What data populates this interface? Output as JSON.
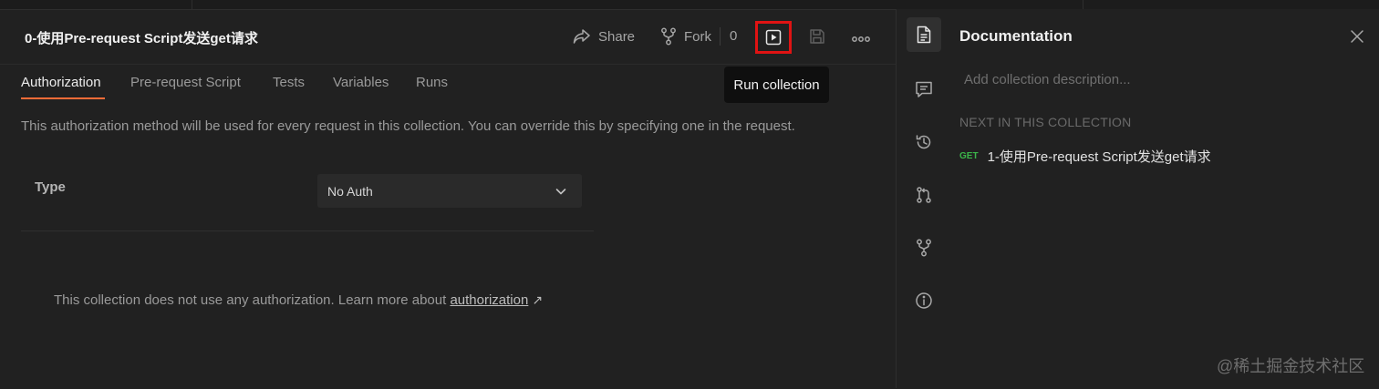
{
  "header": {
    "title": "0-使用Pre-request Script发送get请求",
    "share_label": "Share",
    "fork_label": "Fork",
    "fork_count": "0",
    "tooltip": "Run collection"
  },
  "tabs": [
    {
      "label": "Authorization",
      "active": true
    },
    {
      "label": "Pre-request Script",
      "active": false
    },
    {
      "label": "Tests",
      "active": false
    },
    {
      "label": "Variables",
      "active": false
    },
    {
      "label": "Runs",
      "active": false
    }
  ],
  "auth": {
    "description": "This authorization method will be used for every request in this collection. You can override this by specifying one in the request.",
    "type_label": "Type",
    "type_value": "No Auth",
    "info_text": "This collection does not use any authorization. Learn more about ",
    "info_link": "authorization",
    "info_arrow": "↗"
  },
  "documentation": {
    "title": "Documentation",
    "description_placeholder": "Add collection description...",
    "next_label": "NEXT IN THIS COLLECTION",
    "next_request": {
      "method": "GET",
      "name": "1-使用Pre-request Script发送get请求"
    }
  },
  "rail_icons": [
    "documentation-icon",
    "comments-icon",
    "history-icon",
    "pull-request-icon",
    "fork-icon",
    "info-icon"
  ],
  "watermark": "@稀土掘金技术社区",
  "colors": {
    "accent": "#ff6c37",
    "highlight_box": "#e01313",
    "method_get": "#3bb54a"
  }
}
